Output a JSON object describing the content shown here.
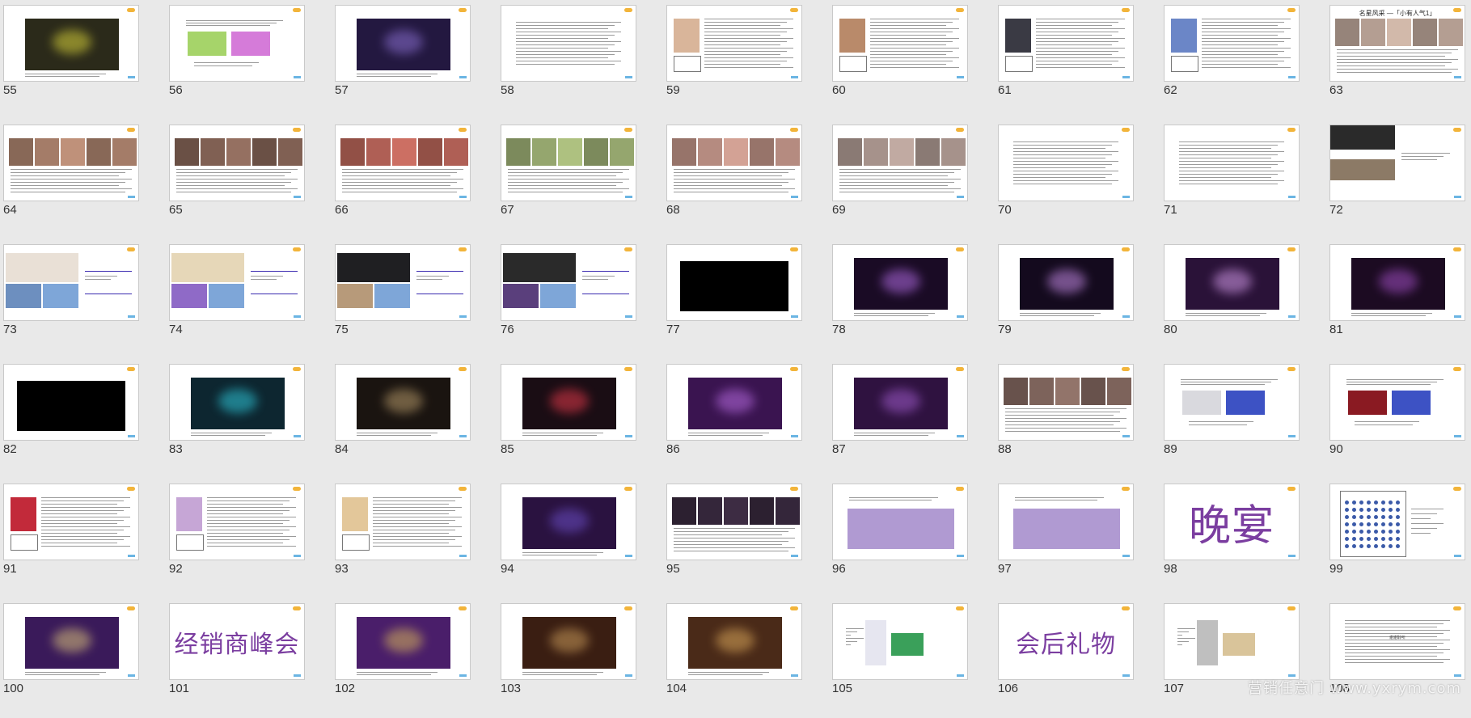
{
  "slides": [
    {
      "number": "55",
      "layout": "image",
      "fill": "#2b2a1a",
      "accent": "#d8d23a"
    },
    {
      "number": "56",
      "layout": "text-image",
      "fill": "#a6d46a",
      "accent": "#d57bd9"
    },
    {
      "number": "57",
      "layout": "image",
      "fill": "#231840",
      "accent": "#8a6fcf"
    },
    {
      "number": "58",
      "layout": "text"
    },
    {
      "number": "59",
      "layout": "profile",
      "fill": "#d9b59a"
    },
    {
      "number": "60",
      "layout": "profile",
      "fill": "#b98a6a"
    },
    {
      "number": "61",
      "layout": "profile",
      "fill": "#3a3a44"
    },
    {
      "number": "62",
      "layout": "profile-small",
      "fill": "#6b86c7"
    },
    {
      "number": "63",
      "layout": "photos",
      "fill": "#c8b0a2",
      "title": "名星风采 —「小有人气1」"
    },
    {
      "number": "64",
      "layout": "photos",
      "fill": "#b68a74"
    },
    {
      "number": "65",
      "layout": "photos",
      "fill": "#8e6b5c"
    },
    {
      "number": "66",
      "layout": "photos",
      "fill": "#c26a5e"
    },
    {
      "number": "67",
      "layout": "photos",
      "fill": "#a6b87a"
    },
    {
      "number": "68",
      "layout": "photos",
      "fill": "#c99a8e"
    },
    {
      "number": "69",
      "layout": "photos",
      "fill": "#b8a29a"
    },
    {
      "number": "70",
      "layout": "text"
    },
    {
      "number": "71",
      "layout": "text"
    },
    {
      "number": "72",
      "layout": "split",
      "fill": "#2a2a2a"
    },
    {
      "number": "73",
      "layout": "collage",
      "fill": "#e9e0d6",
      "accent": "#6d8fbf"
    },
    {
      "number": "74",
      "layout": "collage",
      "fill": "#e6d7b8",
      "accent": "#8f6ac7"
    },
    {
      "number": "75",
      "layout": "collage",
      "fill": "#1f1f22",
      "accent": "#b79a7a"
    },
    {
      "number": "76",
      "layout": "collage",
      "fill": "#2a2a2a",
      "accent": "#5a3f7c"
    },
    {
      "number": "77",
      "layout": "dark-block",
      "fill": "#000000"
    },
    {
      "number": "78",
      "layout": "image",
      "fill": "#1a0b25",
      "accent": "#b16be3"
    },
    {
      "number": "79",
      "layout": "image",
      "fill": "#140a1e",
      "accent": "#c58be6"
    },
    {
      "number": "80",
      "layout": "image",
      "fill": "#2a1238",
      "accent": "#d39ae9"
    },
    {
      "number": "81",
      "layout": "image",
      "fill": "#1c0b22",
      "accent": "#a04ec2"
    },
    {
      "number": "82",
      "layout": "dark-block",
      "fill": "#000000"
    },
    {
      "number": "83",
      "layout": "image",
      "fill": "#0d2630",
      "accent": "#2ec6d8"
    },
    {
      "number": "84",
      "layout": "image",
      "fill": "#1a1410",
      "accent": "#b69a6a"
    },
    {
      "number": "85",
      "layout": "image",
      "fill": "#1a0d14",
      "accent": "#e2394a"
    },
    {
      "number": "86",
      "layout": "image",
      "fill": "#3a1450",
      "accent": "#b76be0"
    },
    {
      "number": "87",
      "layout": "image",
      "fill": "#2f1240",
      "accent": "#9e5ac9"
    },
    {
      "number": "88",
      "layout": "photos",
      "fill": "#8b6e65"
    },
    {
      "number": "89",
      "layout": "text-image",
      "fill": "#d9d9de",
      "accent": "#3d52c4"
    },
    {
      "number": "90",
      "layout": "text-image",
      "fill": "#8a1a22",
      "accent": "#3d52c4"
    },
    {
      "number": "91",
      "layout": "profile",
      "fill": "#c22a3a"
    },
    {
      "number": "92",
      "layout": "profile",
      "fill": "#c6a6d6"
    },
    {
      "number": "93",
      "layout": "profile",
      "fill": "#e3c79a"
    },
    {
      "number": "94",
      "layout": "image",
      "fill": "#2a1240",
      "accent": "#6a4dc4"
    },
    {
      "number": "95",
      "layout": "photos",
      "fill": "#3a2a40"
    },
    {
      "number": "96",
      "layout": "block",
      "fill": "#b09ad2"
    },
    {
      "number": "97",
      "layout": "block",
      "fill": "#b09ad2"
    },
    {
      "number": "98",
      "layout": "big-text",
      "text": "晚宴"
    },
    {
      "number": "99",
      "layout": "seating",
      "fill": "#3b5aa8"
    },
    {
      "number": "100",
      "layout": "image",
      "fill": "#3a1a5a",
      "accent": "#d9c27a"
    },
    {
      "number": "101",
      "layout": "big-text",
      "text": "经销商峰会"
    },
    {
      "number": "102",
      "layout": "image",
      "fill": "#4a1e6a",
      "accent": "#d6b45a"
    },
    {
      "number": "103",
      "layout": "image",
      "fill": "#3a1e12",
      "accent": "#c89a5a"
    },
    {
      "number": "104",
      "layout": "image",
      "fill": "#4a2a18",
      "accent": "#d8a65a"
    },
    {
      "number": "105",
      "layout": "product",
      "fill": "#e6e6f0",
      "accent": "#3aa05a"
    },
    {
      "number": "106",
      "layout": "big-text",
      "text": "会后礼物"
    },
    {
      "number": "107",
      "layout": "product",
      "fill": "#bfbfbf",
      "accent": "#d9c49a"
    },
    {
      "number": "108",
      "layout": "text",
      "title": "谢谢聆听"
    }
  ],
  "watermark": "营销任意门 www.yxrym.com",
  "colors": {
    "background": "#e9e9e9",
    "purple": "#7b3ea0"
  }
}
